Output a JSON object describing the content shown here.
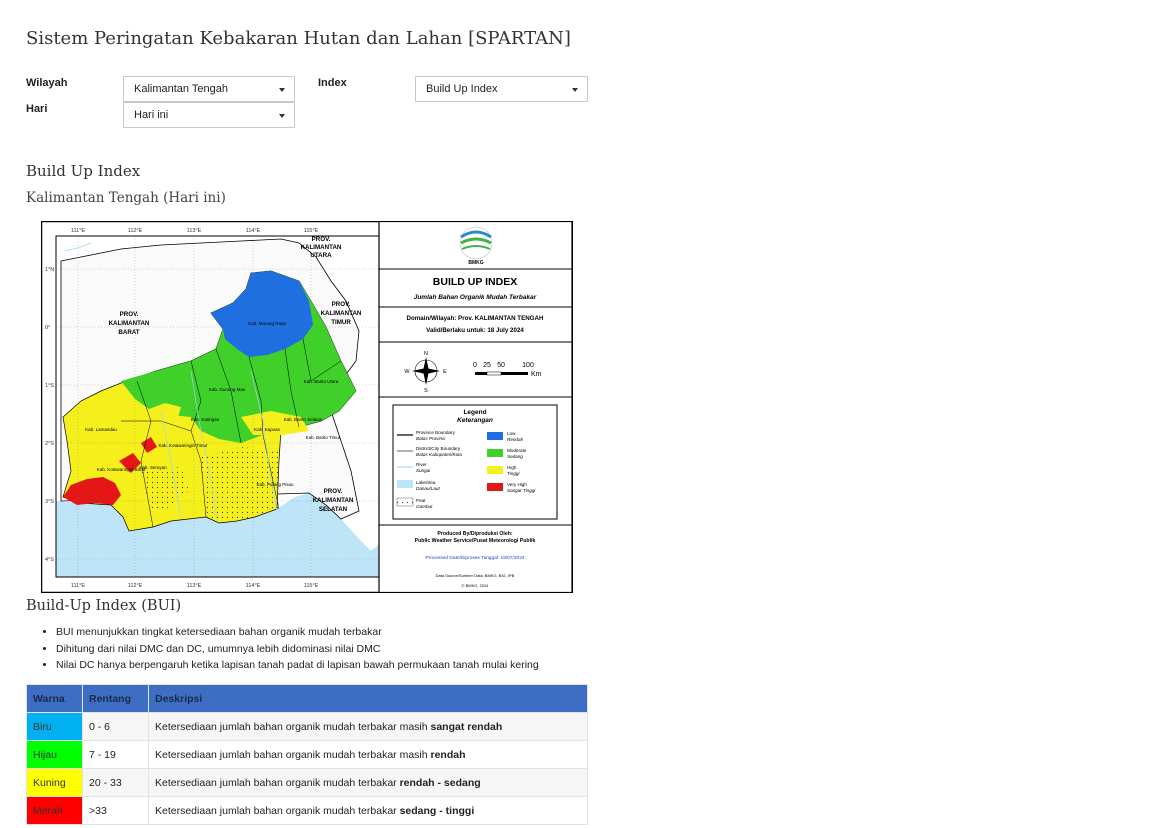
{
  "page_title": "Sistem Peringatan Kebakaran Hutan dan Lahan [SPARTAN]",
  "filters": {
    "wilayah_label": "Wilayah",
    "wilayah_value": "Kalimantan Tengah",
    "hari_label": "Hari",
    "hari_value": "Hari ini",
    "index_label": "Index",
    "index_value": "Build Up Index"
  },
  "section": {
    "title": "Build Up Index",
    "subtitle": "Kalimantan Tengah (Hari ini)"
  },
  "map": {
    "header": "BUILD UP INDEX",
    "subheader": "Jumlah Bahan Organik Mudah Terbakar",
    "domain_line": "Domain/Wilayah: Prov. KALIMANTAN TENGAH",
    "valid_line": "Valid/Berlaku untuk: 18 July 2024",
    "logo_text": "BMKG",
    "scale_labels": [
      "0",
      "25",
      "50",
      "100",
      "Km"
    ],
    "compass": [
      "N",
      "S",
      "W",
      "E"
    ],
    "lon_ticks": [
      "111°E",
      "112°E",
      "113°E",
      "114°E",
      "115°E"
    ],
    "lat_ticks": [
      "1°N",
      "0°",
      "1°S",
      "2°S",
      "3°S",
      "4°S"
    ],
    "provinces": {
      "kaltara": [
        "PROV.",
        "KALIMANTAN",
        "UTARA"
      ],
      "kalbar": [
        "PROV.",
        "KALIMANTAN",
        "BARAT"
      ],
      "kaltim": [
        "PROV.",
        "KALIMANTAN",
        "TIMUR"
      ],
      "kalsel": [
        "PROV.",
        "KALIMANTAN",
        "SELATAN"
      ]
    },
    "districts": [
      "Kab. Murung Raya",
      "Kab. Gunung Mas",
      "Kab. Barito Utara",
      "Kab. Katingan",
      "Kab. Lamandau",
      "Kab. Kotawaringin Timur",
      "Kab. Seruyan",
      "Kab. Kotawaringin Barat",
      "Kab. Kapuas",
      "Kab. Pulang Pisau",
      "Kab. Barito Selatan",
      "Kab. Barito Timur"
    ],
    "legend_title": "Legend",
    "legend_subtitle": "Keterangan",
    "legend_lines": [
      {
        "en": "Province Boundary",
        "id": "Batas Provinsi"
      },
      {
        "en": "District/City Boundary",
        "id": "Batas Kabupaten/Kota"
      },
      {
        "en": "River",
        "id": "Sungai"
      },
      {
        "en": "Lake/Sea",
        "id": "Danau/Laut"
      },
      {
        "en": "Peat",
        "id": "Gambut"
      }
    ],
    "legend_classes": [
      {
        "en": "Low",
        "id": "Rendah",
        "color": "#1f6fe0"
      },
      {
        "en": "Moderate",
        "id": "Sedang",
        "color": "#3fd02a"
      },
      {
        "en": "High",
        "id": "Tinggi",
        "color": "#f5f01e"
      },
      {
        "en": "Very High",
        "id": "Sangat Tinggi",
        "color": "#e51616"
      }
    ],
    "produced_by": "Produced By/Diproduksi Oleh:",
    "producer": "Public Weather Service/Pusat Meteorologi Publik",
    "processed_date": "Processed Date/Diproses Tanggal: 18/07/2024",
    "data_source": "Data Source/Sumber Data: BMKG, BIG, IPB",
    "copyright": "© BMKG, 2024"
  },
  "info": {
    "title": "Build-Up Index (BUI)",
    "bullets": [
      "BUI menunjukkan tingkat ketersediaan bahan organik mudah terbakar",
      "Dihitung dari nilai DMC dan DC, umumnya lebih didominasi nilai DMC",
      "Nilai DC hanya berpengaruh ketika lapisan tanah padat di lapisan bawah permukaan tanah mulai kering"
    ]
  },
  "table": {
    "headers": [
      "Warna",
      "Rentang",
      "Deskripsi"
    ],
    "rows": [
      {
        "warna": "Biru",
        "color": "#00b0f0",
        "rentang": "0 - 6",
        "desc": "Ketersediaan jumlah bahan organik mudah terbakar masih ",
        "desc_bold": "sangat rendah"
      },
      {
        "warna": "Hijau",
        "color": "#00ff00",
        "rentang": "7 - 19",
        "desc": "Ketersediaan jumlah bahan organik mudah terbakar masih ",
        "desc_bold": "rendah"
      },
      {
        "warna": "Kuning",
        "color": "#ffff00",
        "rentang": "20 - 33",
        "desc": "Ketersediaan jumlah bahan organik mudah terbakar ",
        "desc_bold": "rendah - sedang"
      },
      {
        "warna": "Merah",
        "color": "#ff0000",
        "rentang": ">33",
        "desc": "Ketersediaan jumlah bahan organik mudah terbakar ",
        "desc_bold": "sedang - tinggi"
      }
    ]
  }
}
